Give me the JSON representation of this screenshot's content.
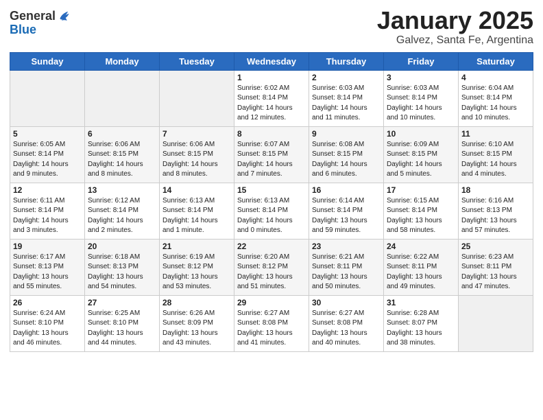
{
  "header": {
    "logo_general": "General",
    "logo_blue": "Blue",
    "title": "January 2025",
    "subtitle": "Galvez, Santa Fe, Argentina"
  },
  "weekdays": [
    "Sunday",
    "Monday",
    "Tuesday",
    "Wednesday",
    "Thursday",
    "Friday",
    "Saturday"
  ],
  "weeks": [
    [
      {
        "day": "",
        "info": ""
      },
      {
        "day": "",
        "info": ""
      },
      {
        "day": "",
        "info": ""
      },
      {
        "day": "1",
        "info": "Sunrise: 6:02 AM\nSunset: 8:14 PM\nDaylight: 14 hours\nand 12 minutes."
      },
      {
        "day": "2",
        "info": "Sunrise: 6:03 AM\nSunset: 8:14 PM\nDaylight: 14 hours\nand 11 minutes."
      },
      {
        "day": "3",
        "info": "Sunrise: 6:03 AM\nSunset: 8:14 PM\nDaylight: 14 hours\nand 10 minutes."
      },
      {
        "day": "4",
        "info": "Sunrise: 6:04 AM\nSunset: 8:14 PM\nDaylight: 14 hours\nand 10 minutes."
      }
    ],
    [
      {
        "day": "5",
        "info": "Sunrise: 6:05 AM\nSunset: 8:14 PM\nDaylight: 14 hours\nand 9 minutes."
      },
      {
        "day": "6",
        "info": "Sunrise: 6:06 AM\nSunset: 8:15 PM\nDaylight: 14 hours\nand 8 minutes."
      },
      {
        "day": "7",
        "info": "Sunrise: 6:06 AM\nSunset: 8:15 PM\nDaylight: 14 hours\nand 8 minutes."
      },
      {
        "day": "8",
        "info": "Sunrise: 6:07 AM\nSunset: 8:15 PM\nDaylight: 14 hours\nand 7 minutes."
      },
      {
        "day": "9",
        "info": "Sunrise: 6:08 AM\nSunset: 8:15 PM\nDaylight: 14 hours\nand 6 minutes."
      },
      {
        "day": "10",
        "info": "Sunrise: 6:09 AM\nSunset: 8:15 PM\nDaylight: 14 hours\nand 5 minutes."
      },
      {
        "day": "11",
        "info": "Sunrise: 6:10 AM\nSunset: 8:15 PM\nDaylight: 14 hours\nand 4 minutes."
      }
    ],
    [
      {
        "day": "12",
        "info": "Sunrise: 6:11 AM\nSunset: 8:14 PM\nDaylight: 14 hours\nand 3 minutes."
      },
      {
        "day": "13",
        "info": "Sunrise: 6:12 AM\nSunset: 8:14 PM\nDaylight: 14 hours\nand 2 minutes."
      },
      {
        "day": "14",
        "info": "Sunrise: 6:13 AM\nSunset: 8:14 PM\nDaylight: 14 hours\nand 1 minute."
      },
      {
        "day": "15",
        "info": "Sunrise: 6:13 AM\nSunset: 8:14 PM\nDaylight: 14 hours\nand 0 minutes."
      },
      {
        "day": "16",
        "info": "Sunrise: 6:14 AM\nSunset: 8:14 PM\nDaylight: 13 hours\nand 59 minutes."
      },
      {
        "day": "17",
        "info": "Sunrise: 6:15 AM\nSunset: 8:14 PM\nDaylight: 13 hours\nand 58 minutes."
      },
      {
        "day": "18",
        "info": "Sunrise: 6:16 AM\nSunset: 8:13 PM\nDaylight: 13 hours\nand 57 minutes."
      }
    ],
    [
      {
        "day": "19",
        "info": "Sunrise: 6:17 AM\nSunset: 8:13 PM\nDaylight: 13 hours\nand 55 minutes."
      },
      {
        "day": "20",
        "info": "Sunrise: 6:18 AM\nSunset: 8:13 PM\nDaylight: 13 hours\nand 54 minutes."
      },
      {
        "day": "21",
        "info": "Sunrise: 6:19 AM\nSunset: 8:12 PM\nDaylight: 13 hours\nand 53 minutes."
      },
      {
        "day": "22",
        "info": "Sunrise: 6:20 AM\nSunset: 8:12 PM\nDaylight: 13 hours\nand 51 minutes."
      },
      {
        "day": "23",
        "info": "Sunrise: 6:21 AM\nSunset: 8:11 PM\nDaylight: 13 hours\nand 50 minutes."
      },
      {
        "day": "24",
        "info": "Sunrise: 6:22 AM\nSunset: 8:11 PM\nDaylight: 13 hours\nand 49 minutes."
      },
      {
        "day": "25",
        "info": "Sunrise: 6:23 AM\nSunset: 8:11 PM\nDaylight: 13 hours\nand 47 minutes."
      }
    ],
    [
      {
        "day": "26",
        "info": "Sunrise: 6:24 AM\nSunset: 8:10 PM\nDaylight: 13 hours\nand 46 minutes."
      },
      {
        "day": "27",
        "info": "Sunrise: 6:25 AM\nSunset: 8:10 PM\nDaylight: 13 hours\nand 44 minutes."
      },
      {
        "day": "28",
        "info": "Sunrise: 6:26 AM\nSunset: 8:09 PM\nDaylight: 13 hours\nand 43 minutes."
      },
      {
        "day": "29",
        "info": "Sunrise: 6:27 AM\nSunset: 8:08 PM\nDaylight: 13 hours\nand 41 minutes."
      },
      {
        "day": "30",
        "info": "Sunrise: 6:27 AM\nSunset: 8:08 PM\nDaylight: 13 hours\nand 40 minutes."
      },
      {
        "day": "31",
        "info": "Sunrise: 6:28 AM\nSunset: 8:07 PM\nDaylight: 13 hours\nand 38 minutes."
      },
      {
        "day": "",
        "info": ""
      }
    ]
  ]
}
